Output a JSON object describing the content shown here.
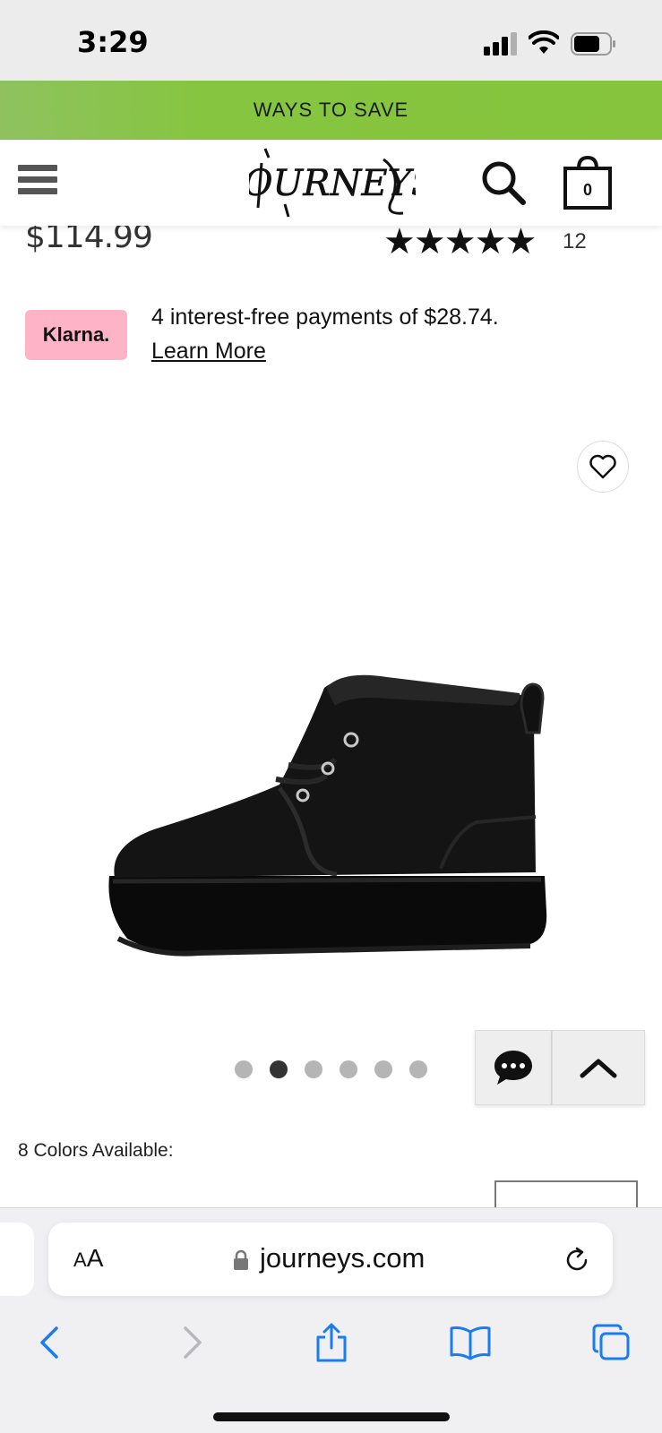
{
  "status_bar": {
    "time": "3:29"
  },
  "promo": {
    "text": "WAYS TO SAVE"
  },
  "header": {
    "logo_alt": "Journeys",
    "cart_count": "0"
  },
  "product": {
    "price": "$114.99",
    "rating_stars": "★★★★★",
    "review_count": "12"
  },
  "klarna": {
    "badge": "Klarna.",
    "text": "4 interest-free payments of $28.74.",
    "link": "Learn More"
  },
  "carousel": {
    "count": 6,
    "active_index": 1
  },
  "colors": {
    "label": "8 Colors Available:"
  },
  "browser": {
    "aa_small": "A",
    "aa_large": "A",
    "url": "journeys.com"
  },
  "theme": {
    "promo_green": "#85c43c",
    "klarna_pink": "#ffb3c7",
    "ios_blue": "#1a7cf5"
  }
}
